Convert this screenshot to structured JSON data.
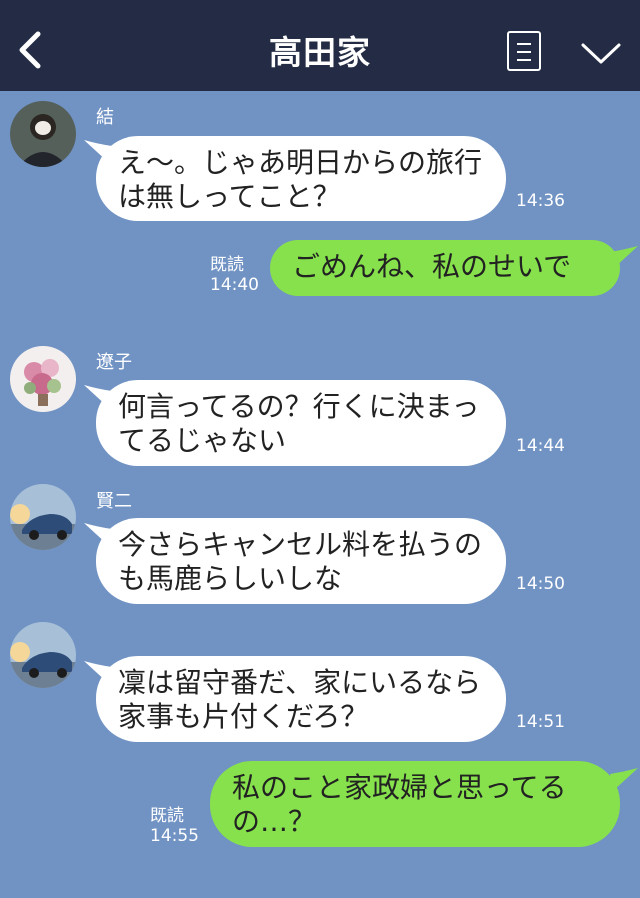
{
  "header": {
    "title": "高田家"
  },
  "messages": [
    {
      "sender": "結",
      "text": "え〜。じゃあ明日からの旅行は無しってこと？",
      "time": "14:36"
    },
    {
      "read": "既読",
      "text": "ごめんね、私のせいで",
      "time": "14:40"
    },
    {
      "sender": "遼子",
      "text": "何言ってるの？行くに決まってるじゃない",
      "time": "14:44"
    },
    {
      "sender": "賢二",
      "text": "今さらキャンセル料を払うのも馬鹿らしいしな",
      "time": "14:50"
    },
    {
      "sender": "",
      "text": "凜は留守番だ、家にいるなら家事も片付くだろ？",
      "time": "14:51"
    },
    {
      "read": "既読",
      "text": "私のこと家政婦と思ってるの…？",
      "time": "14:55"
    }
  ],
  "colors": {
    "background": "#7193c4",
    "header": "#232c44",
    "incoming": "#ffffff",
    "outgoing": "#86e14c"
  },
  "icons": [
    "back-icon",
    "menu-icon",
    "chevron-down-icon"
  ]
}
